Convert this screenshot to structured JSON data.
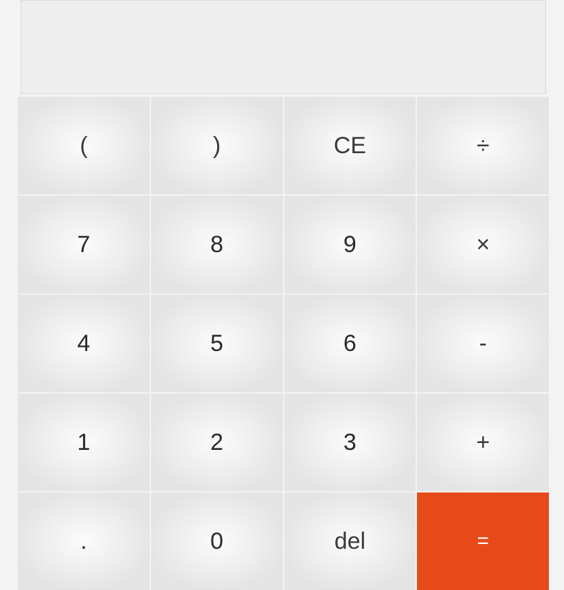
{
  "display": {
    "value": ""
  },
  "keys": {
    "row0": {
      "paren_open": "(",
      "paren_close": ")",
      "clear_entry": "CE",
      "divide": "÷"
    },
    "row1": {
      "seven": "7",
      "eight": "8",
      "nine": "9",
      "multiply": "×"
    },
    "row2": {
      "four": "4",
      "five": "5",
      "six": "6",
      "minus": "-"
    },
    "row3": {
      "one": "1",
      "two": "2",
      "three": "3",
      "plus": "+"
    },
    "row4": {
      "decimal": ".",
      "zero": "0",
      "delete": "del",
      "equals": "="
    }
  },
  "colors": {
    "equals_bg": "#e64a19",
    "key_bg_center": "#fbfbfb",
    "key_bg_edge": "#e4e4e4",
    "display_bg": "#eeeeee",
    "page_bg": "#f3f3f3"
  }
}
